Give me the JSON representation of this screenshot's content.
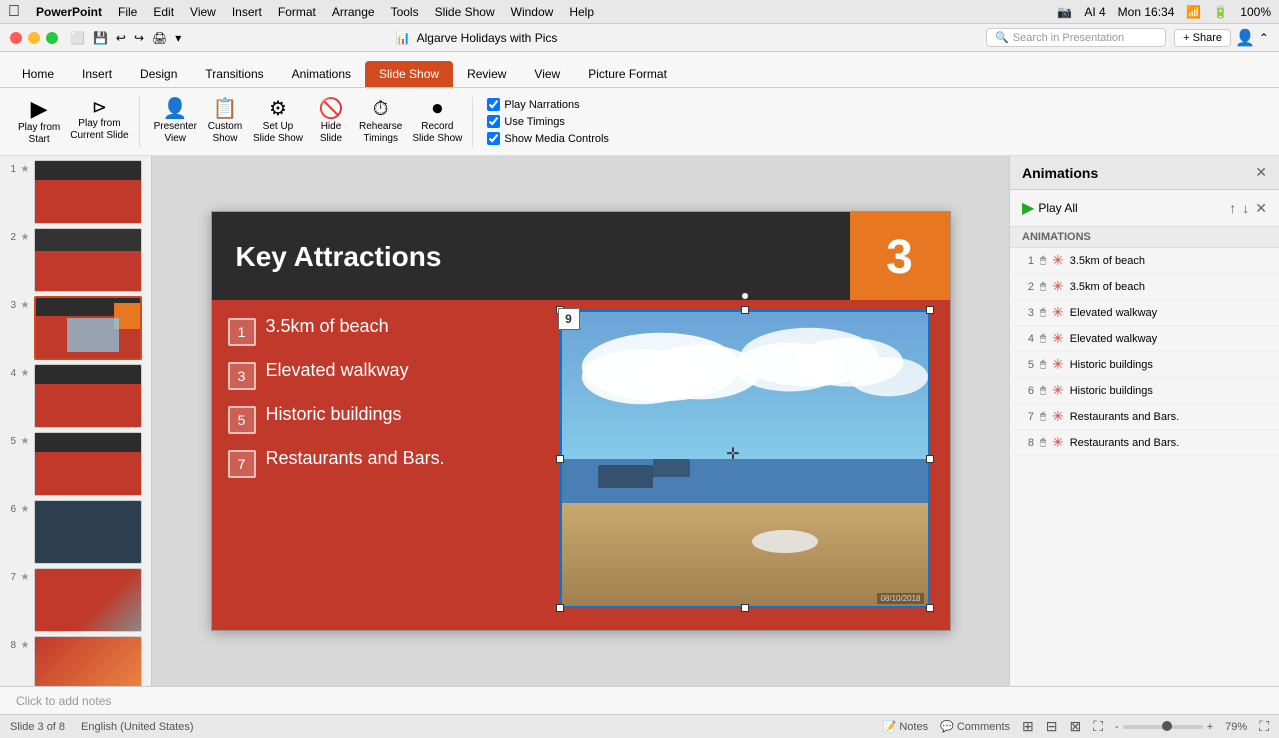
{
  "menubar": {
    "apple": "⌘",
    "app_name": "PowerPoint",
    "menus": [
      "File",
      "Edit",
      "View",
      "Insert",
      "Format",
      "Arrange",
      "Tools",
      "Slide Show",
      "Window",
      "Help"
    ],
    "right": "Mon 16:34"
  },
  "titlebar": {
    "toolbar_icons": [
      "□",
      "💾",
      "↩",
      "↪",
      "🖨",
      "▾"
    ],
    "title": "Algarve Holidays with Pics",
    "search_placeholder": "Search in Presentation",
    "share_label": "+ Share"
  },
  "tabs": [
    {
      "label": "Home",
      "active": false
    },
    {
      "label": "Insert",
      "active": false
    },
    {
      "label": "Design",
      "active": false
    },
    {
      "label": "Transitions",
      "active": false
    },
    {
      "label": "Animations",
      "active": false
    },
    {
      "label": "Slide Show",
      "active": true
    },
    {
      "label": "Review",
      "active": false
    },
    {
      "label": "View",
      "active": false
    },
    {
      "label": "Picture Format",
      "active": false
    }
  ],
  "ribbon": {
    "groups": [
      {
        "buttons": [
          {
            "icon": "▶",
            "label": "Play from\nStart"
          },
          {
            "icon": "⊳",
            "label": "Play from\nCurrent Slide"
          }
        ]
      },
      {
        "buttons": [
          {
            "icon": "👤",
            "label": "Presenter\nView"
          },
          {
            "icon": "🎞",
            "label": "Custom\nShow"
          },
          {
            "icon": "⚙",
            "label": "Set Up\nSlide Show"
          },
          {
            "icon": "🙈",
            "label": "Hide\nSlide"
          },
          {
            "icon": "⏱",
            "label": "Rehearse\nTimings"
          },
          {
            "icon": "⏺",
            "label": "Record\nSlide Show"
          }
        ]
      },
      {
        "checkboxes": [
          {
            "label": "Play Narrations",
            "checked": true
          },
          {
            "label": "Use Timings",
            "checked": true
          },
          {
            "label": "Show Media Controls",
            "checked": true
          }
        ]
      }
    ]
  },
  "slides": [
    {
      "num": "1",
      "star": "★",
      "type": "t1"
    },
    {
      "num": "2",
      "star": "★",
      "type": "t2"
    },
    {
      "num": "3",
      "star": "★",
      "type": "t3",
      "active": true
    },
    {
      "num": "4",
      "star": "★",
      "type": "t4"
    },
    {
      "num": "5",
      "star": "★",
      "type": "t5"
    },
    {
      "num": "6",
      "star": "★",
      "type": "t6"
    },
    {
      "num": "7",
      "star": "★",
      "type": "t7"
    },
    {
      "num": "8",
      "star": "★",
      "type": "t1"
    }
  ],
  "slide": {
    "title": "Key Attractions",
    "number": "3",
    "bullets": [
      {
        "num": "1",
        "text": "3.5km of beach"
      },
      {
        "num": "3",
        "text": "Elevated walkway"
      },
      {
        "num": "5",
        "text": "Historic buildings"
      },
      {
        "num": "7",
        "text": "Restaurants and Bars."
      }
    ],
    "img_badge": "9",
    "img_date": "08/10/2018"
  },
  "notes": {
    "placeholder": "Click to add notes",
    "label": "Notes"
  },
  "animations": {
    "panel_title": "Animations",
    "play_all_label": "Play All",
    "list_header": "ANIMATIONS",
    "items": [
      {
        "num": "1",
        "label": "3.5km of beach"
      },
      {
        "num": "2",
        "label": "3.5km of beach"
      },
      {
        "num": "3",
        "label": "Elevated walkway"
      },
      {
        "num": "4",
        "label": "Elevated walkway"
      },
      {
        "num": "5",
        "label": "Historic buildings"
      },
      {
        "num": "6",
        "label": "Historic buildings"
      },
      {
        "num": "7",
        "label": "Restaurants and Bars."
      },
      {
        "num": "8",
        "label": "Restaurants and Bars."
      }
    ]
  },
  "statusbar": {
    "slide_info": "Slide 3 of 8",
    "language": "English (United States)",
    "zoom_level": "79%"
  }
}
